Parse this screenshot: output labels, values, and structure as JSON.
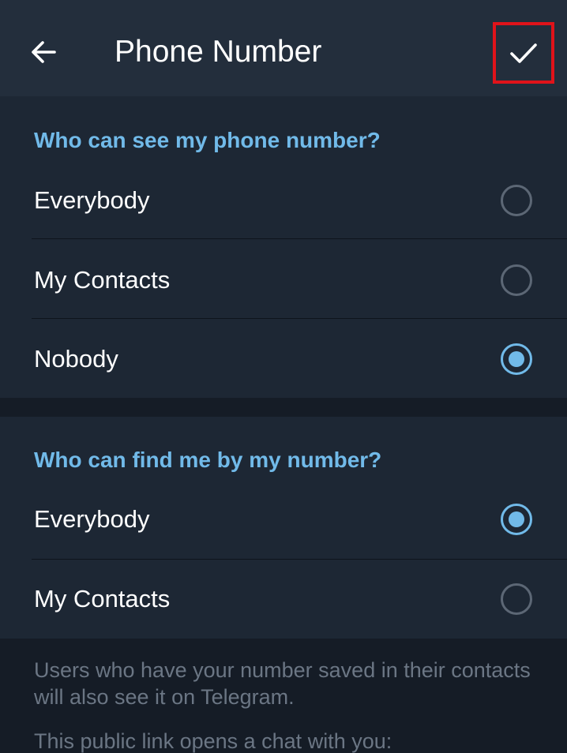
{
  "header": {
    "title": "Phone Number",
    "back_icon": "arrow-left-icon",
    "done_icon": "check-icon"
  },
  "see_section": {
    "title": "Who can see my phone number?",
    "options": [
      {
        "label": "Everybody",
        "selected": false
      },
      {
        "label": "My Contacts",
        "selected": false
      },
      {
        "label": "Nobody",
        "selected": true
      }
    ]
  },
  "find_section": {
    "title": "Who can find me by my number?",
    "options": [
      {
        "label": "Everybody",
        "selected": true
      },
      {
        "label": "My Contacts",
        "selected": false
      }
    ]
  },
  "footer": {
    "info_text": "Users who have your number saved in their contacts will also see it on Telegram.",
    "link_text": "This public link opens a chat with you:"
  },
  "colors": {
    "accent": "#71bae9",
    "highlight_box": "#e0131a",
    "appbar": "#232e3c",
    "section_bg": "#1d2734",
    "page_bg": "#151c26"
  }
}
